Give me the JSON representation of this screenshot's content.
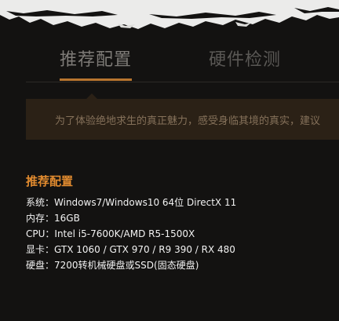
{
  "tabs": [
    {
      "label": "推荐配置",
      "active": true
    },
    {
      "label": "硬件检测",
      "active": false
    }
  ],
  "notice": {
    "text": "为了体验绝地求生的真正魅力，感受身临其境的真实，建议"
  },
  "recommended": {
    "title": "推荐配置",
    "specs": [
      {
        "label": "系统：",
        "value": "Windows7/Windows10 64位 DirectX 11"
      },
      {
        "label": "内存：",
        "value": "16GB"
      },
      {
        "label": "CPU：",
        "value": "Intel i5-7600K/AMD R5-1500X"
      },
      {
        "label": "显卡：",
        "value": "GTX 1060 / GTX 970 / R9 390 / RX 480"
      },
      {
        "label": "硬盘：",
        "value": "7200转机械硬盘或SSD(固态硬盘)"
      }
    ]
  },
  "colors": {
    "accent": "#e08a2f",
    "tab_underline": "#b8752f",
    "notice_bg": "#2b2116",
    "background": "#131211"
  }
}
